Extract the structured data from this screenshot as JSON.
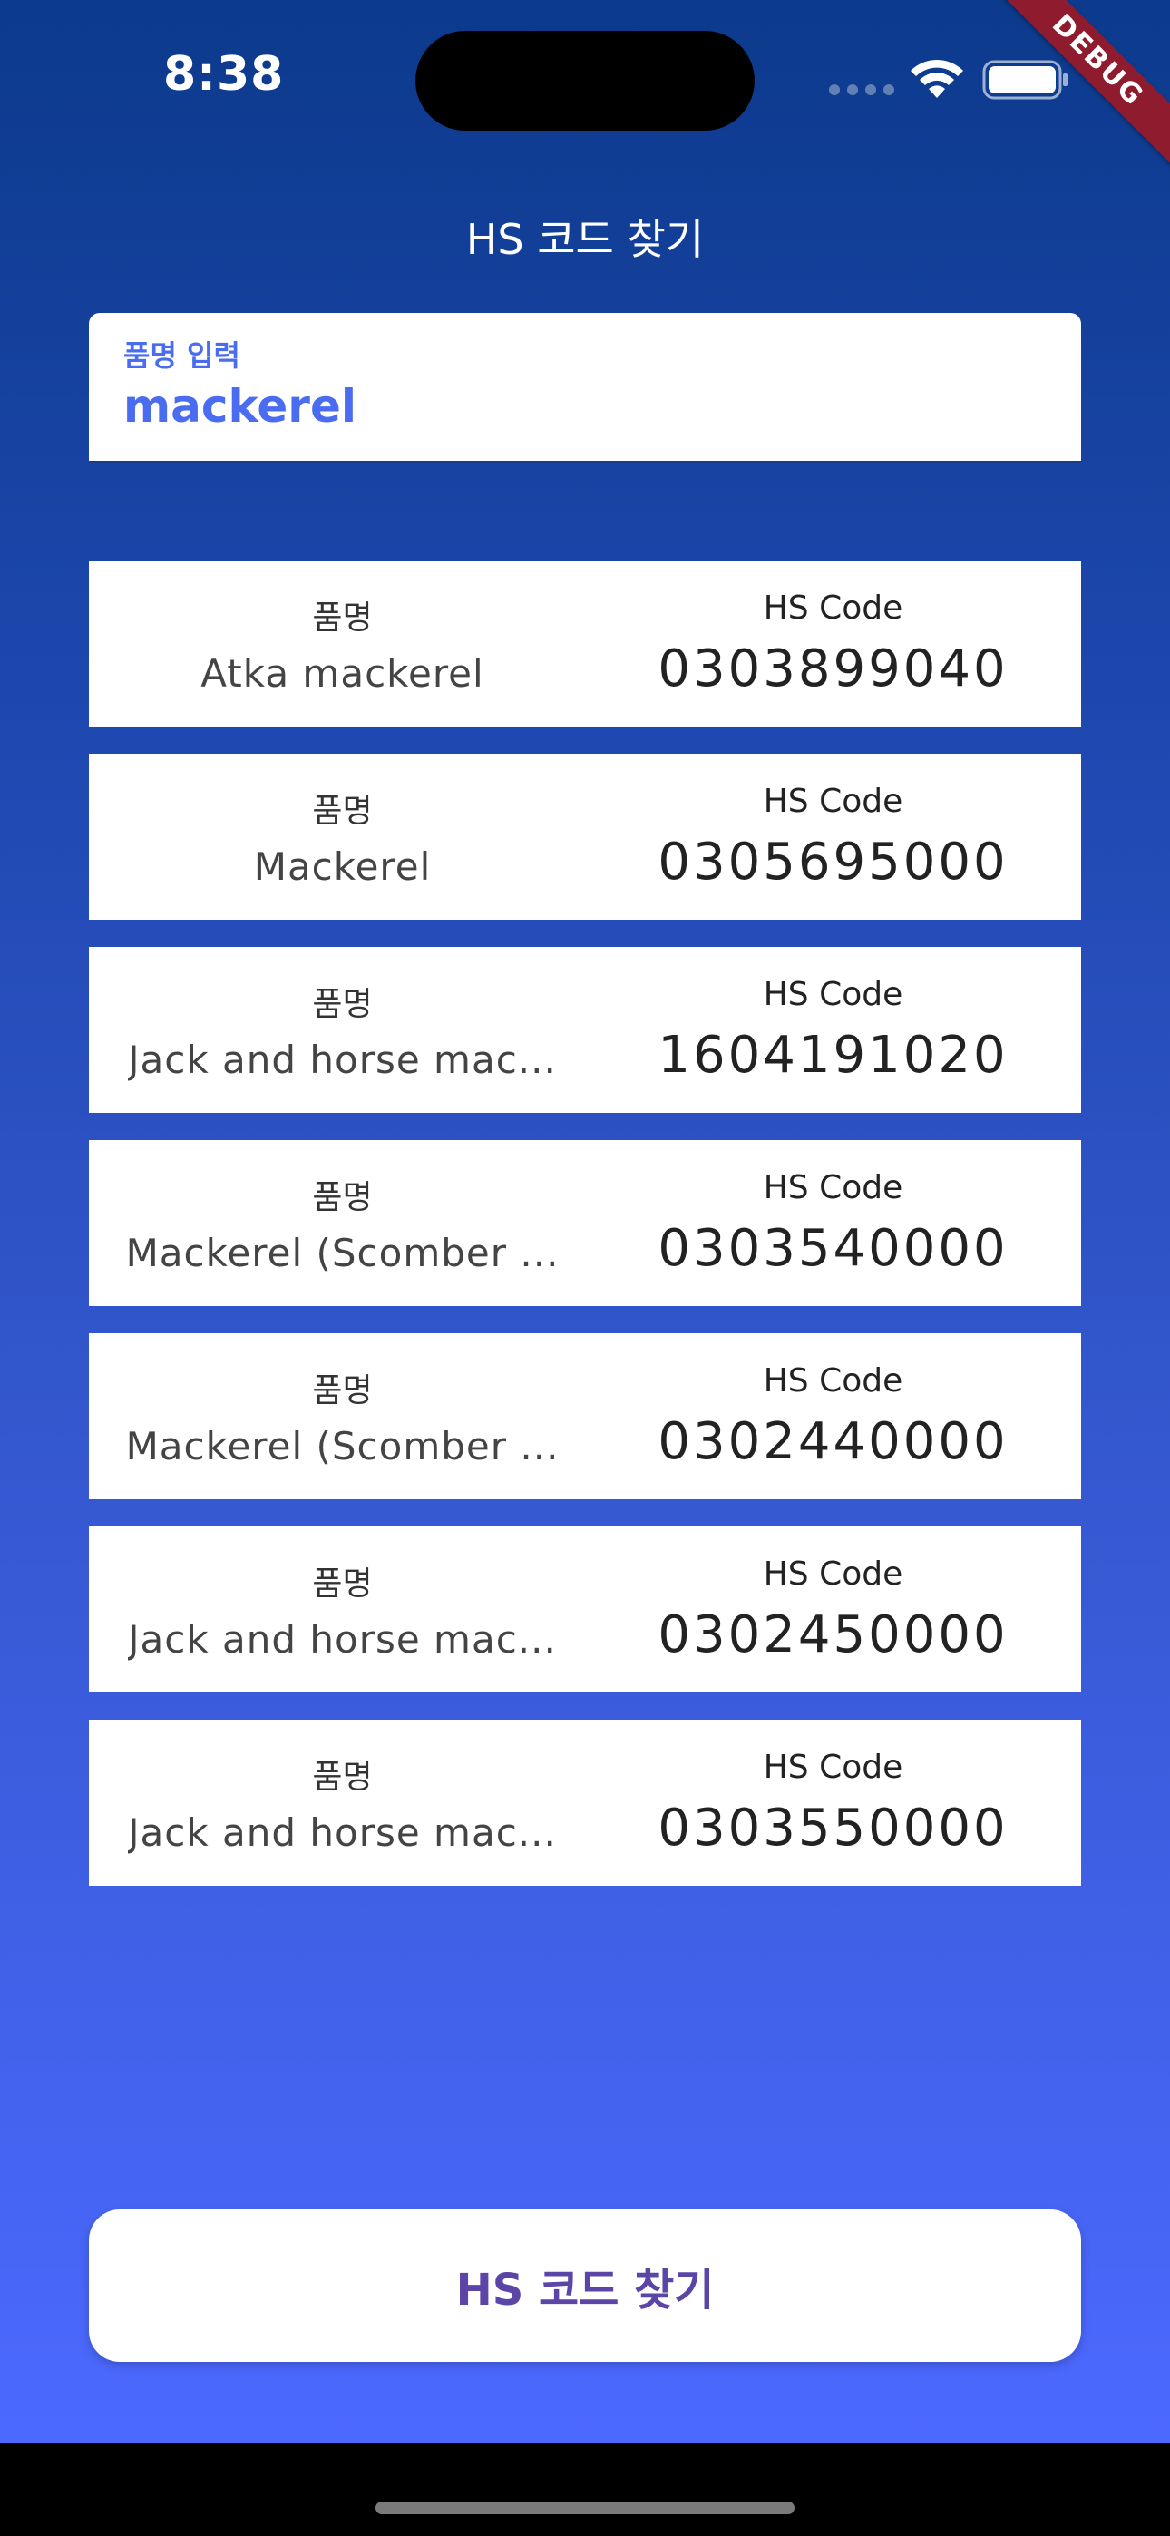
{
  "status_bar": {
    "time": "8:38",
    "debug_label": "DEBUG"
  },
  "page_title": "HS 코드 찾기",
  "search_input": {
    "label": "품명 입력",
    "value": "mackerel"
  },
  "results": [
    {
      "name_label": "품명",
      "name": "Atka mackerel",
      "code_label": "HS Code",
      "code": "0303899040"
    },
    {
      "name_label": "품명",
      "name": "Mackerel",
      "code_label": "HS Code",
      "code": "0305695000"
    },
    {
      "name_label": "품명",
      "name": "Jack and horse mac...",
      "code_label": "HS Code",
      "code": "1604191020"
    },
    {
      "name_label": "품명",
      "name": "Mackerel (Scomber ...",
      "code_label": "HS Code",
      "code": "0303540000"
    },
    {
      "name_label": "품명",
      "name": "Mackerel (Scomber ...",
      "code_label": "HS Code",
      "code": "0302440000"
    },
    {
      "name_label": "품명",
      "name": "Jack and horse mac...",
      "code_label": "HS Code",
      "code": "0302450000"
    },
    {
      "name_label": "품명",
      "name": "Jack and horse mac...",
      "code_label": "HS Code",
      "code": "0303550000"
    }
  ],
  "search_button": {
    "label": "HS 코드 찾기"
  },
  "colors": {
    "accent": "#4a6cf0",
    "button_text": "#5b46a8",
    "gradient_top": "#0c3a8c",
    "gradient_bottom": "#4c69ff",
    "debug_ribbon": "#8e1c2e"
  },
  "icons": {
    "wifi": "wifi-icon",
    "battery": "battery-icon",
    "signal": "signal-dots-icon"
  }
}
